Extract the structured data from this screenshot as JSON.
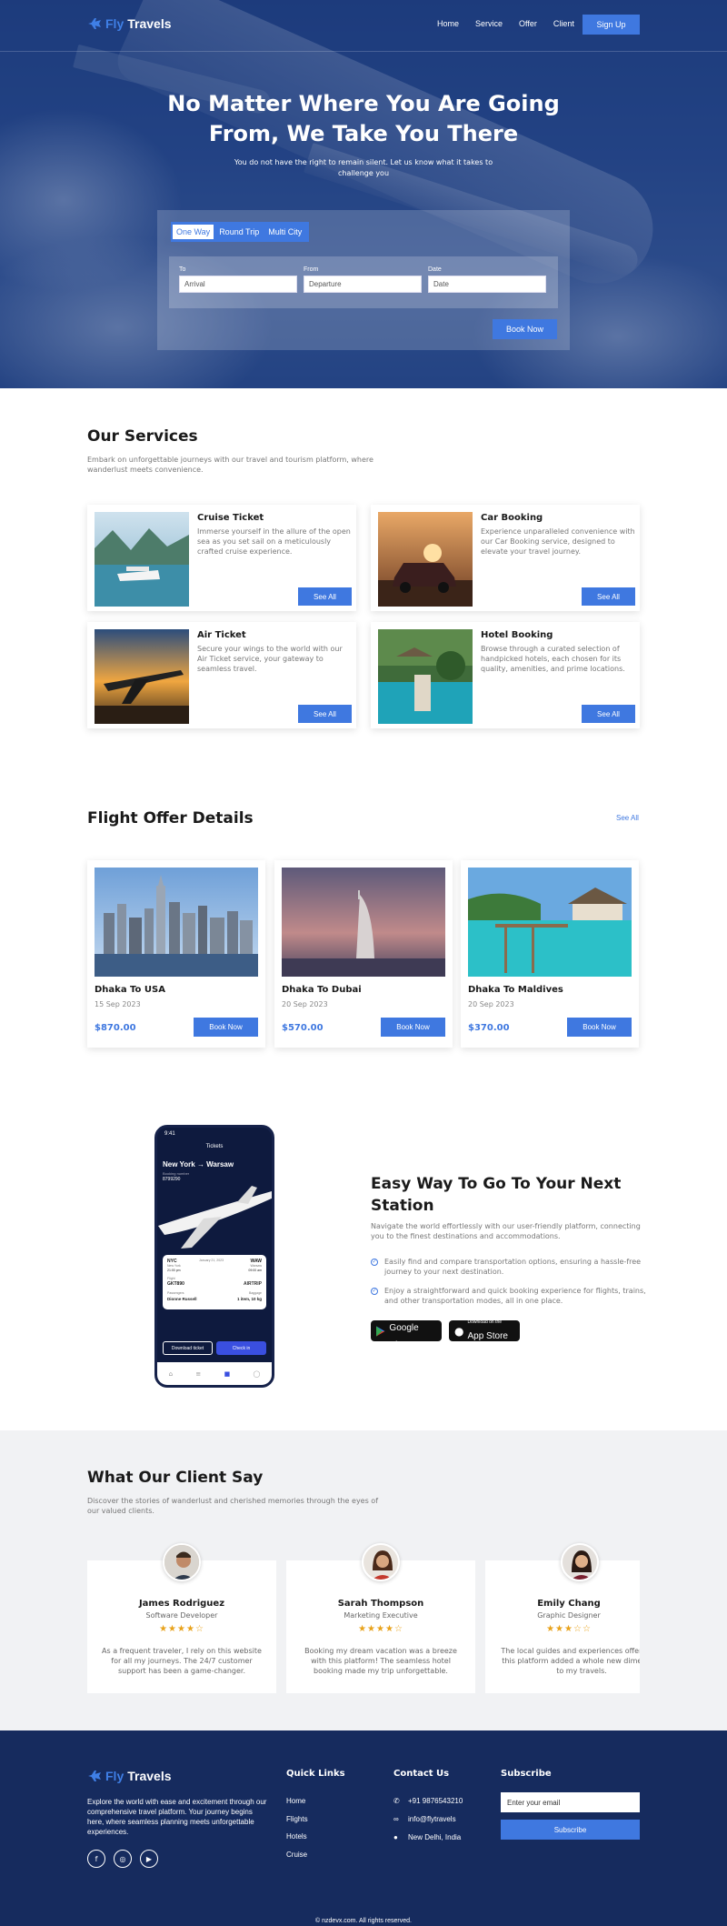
{
  "brand": {
    "fly": "Fly",
    "travels": "Travels"
  },
  "nav": {
    "items": [
      "Home",
      "Service",
      "Offer",
      "Client"
    ],
    "signup": "Sign Up"
  },
  "hero": {
    "title_line1": "No Matter Where You Are Going",
    "title_line2": "From, We Take You There",
    "subtitle_line1": "You do not have the right to remain silent. Let us know what it takes to",
    "subtitle_line2": "challenge you"
  },
  "booking": {
    "tabs": [
      "One Way",
      "Round Trip",
      "Multi City"
    ],
    "active_tab": "One Way",
    "fields": [
      {
        "label": "To",
        "placeholder": "Arrival"
      },
      {
        "label": "From",
        "placeholder": "Departure"
      },
      {
        "label": "Date",
        "placeholder": "Date"
      }
    ],
    "submit": "Book Now"
  },
  "services": {
    "title": "Our Services",
    "subtitle_line1": "Embark on unforgettable journeys with our travel and tourism platform, where",
    "subtitle_line2": "wanderlust meets convenience.",
    "cards": [
      {
        "title": "Cruise Ticket",
        "desc": "Immerse yourself in the allure of the open sea as you set sail on a meticulously crafted cruise experience.",
        "button": "See All"
      },
      {
        "title": "Car Booking",
        "desc": "Experience unparalleled convenience with our Car Booking service, designed to elevate your travel journey.",
        "button": "See All"
      },
      {
        "title": "Air Ticket",
        "desc": "Secure your wings to the world with our Air Ticket service, your gateway to seamless travel.",
        "button": "See All"
      },
      {
        "title": "Hotel Booking",
        "desc": "Browse through a curated selection of handpicked hotels, each chosen for its quality, amenities, and prime locations.",
        "button": "See All"
      }
    ]
  },
  "offers": {
    "title": "Flight Offer Details",
    "see_all": "See All",
    "cards": [
      {
        "title": "Dhaka To USA",
        "date": "15 Sep 2023",
        "price": "$870.00",
        "button": "Book Now"
      },
      {
        "title": "Dhaka To Dubai",
        "date": "20 Sep 2023",
        "price": "$570.00",
        "button": "Book Now"
      },
      {
        "title": "Dhaka To Maldives",
        "date": "20 Sep 2023",
        "price": "$370.00",
        "button": "Book Now"
      }
    ]
  },
  "app": {
    "title_line1": "Easy Way To Go To Your Next",
    "title_line2": "Station",
    "desc_line1": "Navigate the world effortlessly with our user-friendly platform, connecting",
    "desc_line2": "you to the finest destinations and accommodations.",
    "features": [
      {
        "line1": "Easily find and compare transportation options, ensuring a hassle-free",
        "line2": "journey to your next destination."
      },
      {
        "line1": "Enjoy a straightforward and quick booking experience for flights, trains,",
        "line2": "and other transportation modes, all in one place."
      }
    ],
    "google_small": "GET IT ON",
    "google_big": "Google Play",
    "apple_small": "Download on the",
    "apple_big": "App Store",
    "phone": {
      "time": "9:41",
      "header": "Tickets",
      "route": "New York → Warsaw",
      "booking_label": "Booking number",
      "booking_number": "8799290",
      "from_code": "NYC",
      "from_city": "New York",
      "from_time": "21:00 pm",
      "to_code": "WAW",
      "to_city": "Warsaw",
      "to_time": "09:00 am",
      "date": "January 21, 2023",
      "flight_label": "Flight",
      "flight": "GKT890",
      "airline": "AIRTRIP",
      "passenger_label": "Passengers",
      "passenger": "Dionne Russell",
      "baggage_label": "Baggage",
      "baggage": "1 item, 10 kg",
      "download": "Download ticket",
      "checkin": "Check in"
    }
  },
  "testimonials": {
    "title": "What Our Client Say",
    "subtitle_line1": "Discover the stories of wanderlust and cherished memories through the eyes of",
    "subtitle_line2": "our valued clients.",
    "cards": [
      {
        "name": "James Rodriguez",
        "role": "Software Developer",
        "stars": 4,
        "stars_text": "★★★★☆",
        "quote": "As a frequent traveler, I rely on this website for all my journeys. The 24/7 customer support has been a game-changer."
      },
      {
        "name": "Sarah Thompson",
        "role": "Marketing Executive",
        "stars": 4,
        "stars_text": "★★★★☆",
        "quote": "Booking my dream vacation was a breeze with this platform! The seamless hotel booking made my trip unforgettable."
      },
      {
        "name": "Emily Chang",
        "role": "Graphic Designer",
        "stars": 3,
        "stars_text": "★★★☆☆",
        "quote": "The local guides and experiences offered by this platform added a whole new dimension to my travels."
      }
    ]
  },
  "footer": {
    "desc": "Explore the world with ease and excitement through our comprehensive travel platform. Your journey begins here, where seamless planning meets unforgettable experiences.",
    "quick_links_title": "Quick Links",
    "quick_links": [
      "Home",
      "Flights",
      "Hotels",
      "Cruise"
    ],
    "contact_title": "Contact Us",
    "phone": "+91 9876543210",
    "handle": "info@flytravels",
    "location": "New Delhi, India",
    "subscribe_title": "Subscribe",
    "email_placeholder": "Enter your email",
    "subscribe_button": "Subscribe",
    "copyright": "© nzdevx.com. All rights reserved."
  },
  "colors": {
    "accent": "#3f78e0",
    "footer": "#162b5e",
    "hero": "#244686",
    "stars": "#e8a21b"
  }
}
